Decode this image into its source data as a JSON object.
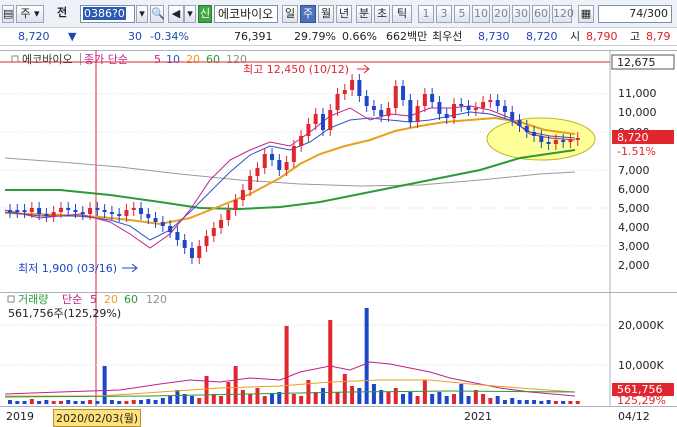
{
  "toolbar": {
    "market_select": "주",
    "prev_label": "전",
    "code_value": "0386?0",
    "credit_badge": "신",
    "stock_name": "에코바이오",
    "period_buttons": [
      "일",
      "주",
      "월",
      "년",
      "분",
      "초",
      "틱"
    ],
    "selected_period": "주",
    "interval_buttons": [
      "1",
      "3",
      "5",
      "10",
      "20",
      "30",
      "60",
      "120"
    ],
    "count_value": "74",
    "count_total": "/300"
  },
  "quote": {
    "price": "8,720",
    "change": "30",
    "change_pct": "-0.34%",
    "volume": "76,391",
    "turnover_pct": "29.79%",
    "extra_pct": "0.66%",
    "trade_value": "662백만",
    "best_ask_label": "최우선",
    "best_ask": "8,730",
    "best_bid": "8,720",
    "open_label": "시",
    "open": "8,790",
    "high_label": "고",
    "high": "8,79"
  },
  "price_panel": {
    "legend": {
      "name": "에코바이오",
      "ma_label": "종가 단순",
      "ma_periods": [
        "5",
        "10",
        "20",
        "60",
        "120"
      ],
      "ma_colors": [
        "#c0208f",
        "#2b55c8",
        "#e8a020",
        "#2a9a3a",
        "#909090"
      ]
    },
    "high_annotation": "최고 12,450 (10/12)",
    "low_annotation": "최저 1,900 (03/16)",
    "y_axis_labels": [
      "11,000",
      "10,000",
      "9,000",
      "7,000",
      "6,000",
      "5,000",
      "4,000",
      "3,000",
      "2,000"
    ],
    "current_price_tag": "8,720",
    "current_pct_tag": "-1.51%",
    "max_tag": "12,675"
  },
  "volume_panel": {
    "legend_label": "거래량",
    "ma_label": "단순",
    "ma_periods": [
      "5",
      "20",
      "60",
      "120"
    ],
    "current_volume": "561,756주(125,29%)",
    "y_axis_labels": [
      "20,000K",
      "10,000K"
    ],
    "current_vol_tag": "561,756",
    "current_vol_pct_tag": "125,29%"
  },
  "x_axis": {
    "labels": [
      "2019",
      "2020/02/03(월)",
      "2021",
      "04/12"
    ]
  },
  "colors": {
    "up": "#e0262e",
    "down": "#1e46c8",
    "highlight": "#ffff9a"
  }
}
